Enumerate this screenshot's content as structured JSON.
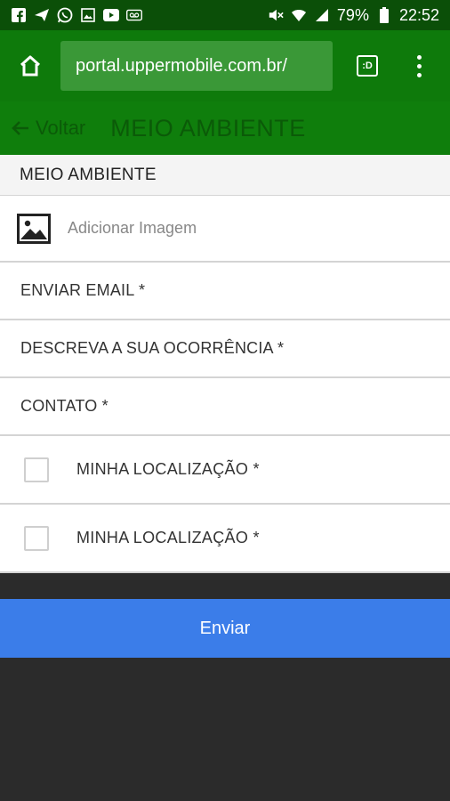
{
  "status_bar": {
    "battery": "79%",
    "time": "22:52"
  },
  "browser": {
    "url": "portal.uppermobile.com.br/",
    "tabs_count": ":D"
  },
  "header": {
    "back_label": "Voltar",
    "title": "MEIO AMBIENTE"
  },
  "form": {
    "section_title": "MEIO AMBIENTE",
    "image_label": "Adicionar Imagem",
    "fields": [
      "ENVIAR EMAIL *",
      "DESCREVA A SUA OCORRÊNCIA *",
      "CONTATO *"
    ],
    "checkboxes": [
      {
        "label": "MINHA LOCALIZAÇÃO *",
        "checked": false
      },
      {
        "label": "MINHA LOCALIZAÇÃO *",
        "checked": false
      }
    ],
    "submit_label": "Enviar"
  },
  "colors": {
    "status_bar": "#0b4f08",
    "browser_bar": "#0e7a0b",
    "submit": "#3b7de9",
    "background": "#2b2b2b"
  }
}
